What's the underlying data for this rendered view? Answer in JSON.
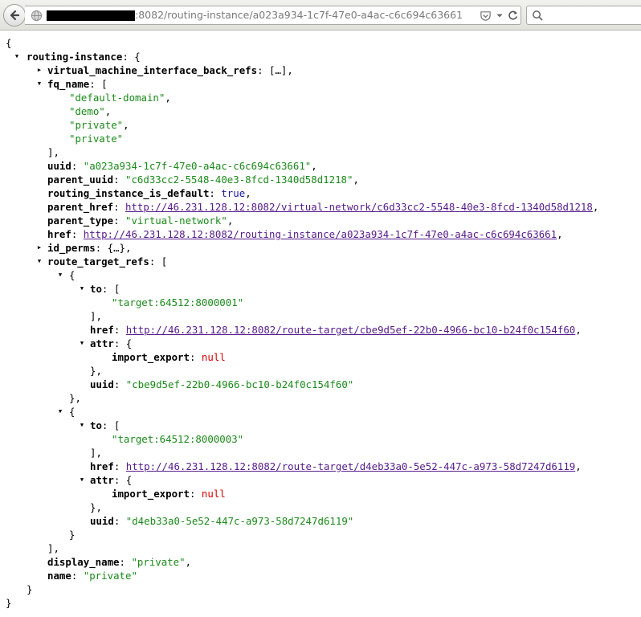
{
  "browser": {
    "url_visible": ":8082/routing-instance/a023a934-1c7f-47e0-a4ac-c6c694c63661",
    "search_placeholder": ""
  },
  "json": {
    "root_open": "{",
    "root_close": "}",
    "routing_instance": {
      "key": "routing-instance",
      "open": "{",
      "close": "}",
      "vmi_back_refs": {
        "key": "virtual_machine_interface_back_refs",
        "collapsed": "[…]"
      },
      "fq_name": {
        "key": "fq_name",
        "values": [
          "\"default-domain\"",
          "\"demo\"",
          "\"private\"",
          "\"private\""
        ]
      },
      "uuid": {
        "key": "uuid",
        "value": "\"a023a934-1c7f-47e0-a4ac-c6c694c63661\""
      },
      "parent_uuid": {
        "key": "parent_uuid",
        "value": "\"c6d33cc2-5548-40e3-8fcd-1340d58d1218\""
      },
      "routing_instance_is_default": {
        "key": "routing_instance_is_default",
        "value": "true"
      },
      "parent_href": {
        "key": "parent_href",
        "value": "http://46.231.128.12:8082/virtual-network/c6d33cc2-5548-40e3-8fcd-1340d58d1218"
      },
      "parent_type": {
        "key": "parent_type",
        "value": "\"virtual-network\""
      },
      "href": {
        "key": "href",
        "value": "http://46.231.128.12:8082/routing-instance/a023a934-1c7f-47e0-a4ac-c6c694c63661"
      },
      "id_perms": {
        "key": "id_perms",
        "collapsed": "{…}"
      },
      "route_target_refs": {
        "key": "route_target_refs",
        "items": [
          {
            "to_key": "to",
            "to": "\"target:64512:8000001\"",
            "href_key": "href",
            "href": "http://46.231.128.12:8082/route-target/cbe9d5ef-22b0-4966-bc10-b24f0c154f60",
            "attr_key": "attr",
            "import_export_key": "import_export",
            "import_export": "null",
            "uuid_key": "uuid",
            "uuid": "\"cbe9d5ef-22b0-4966-bc10-b24f0c154f60\""
          },
          {
            "to_key": "to",
            "to": "\"target:64512:8000003\"",
            "href_key": "href",
            "href": "http://46.231.128.12:8082/route-target/d4eb33a0-5e52-447c-a973-58d7247d6119",
            "attr_key": "attr",
            "import_export_key": "import_export",
            "import_export": "null",
            "uuid_key": "uuid",
            "uuid": "\"d4eb33a0-5e52-447c-a973-58d7247d6119\""
          }
        ]
      },
      "display_name": {
        "key": "display_name",
        "value": "\"private\""
      },
      "name": {
        "key": "name",
        "value": "\"private\""
      }
    }
  },
  "colors": {
    "string": "#1a8a1a",
    "boolean": "#1a1aa6",
    "null": "#d70000",
    "link": "#551a8b"
  }
}
